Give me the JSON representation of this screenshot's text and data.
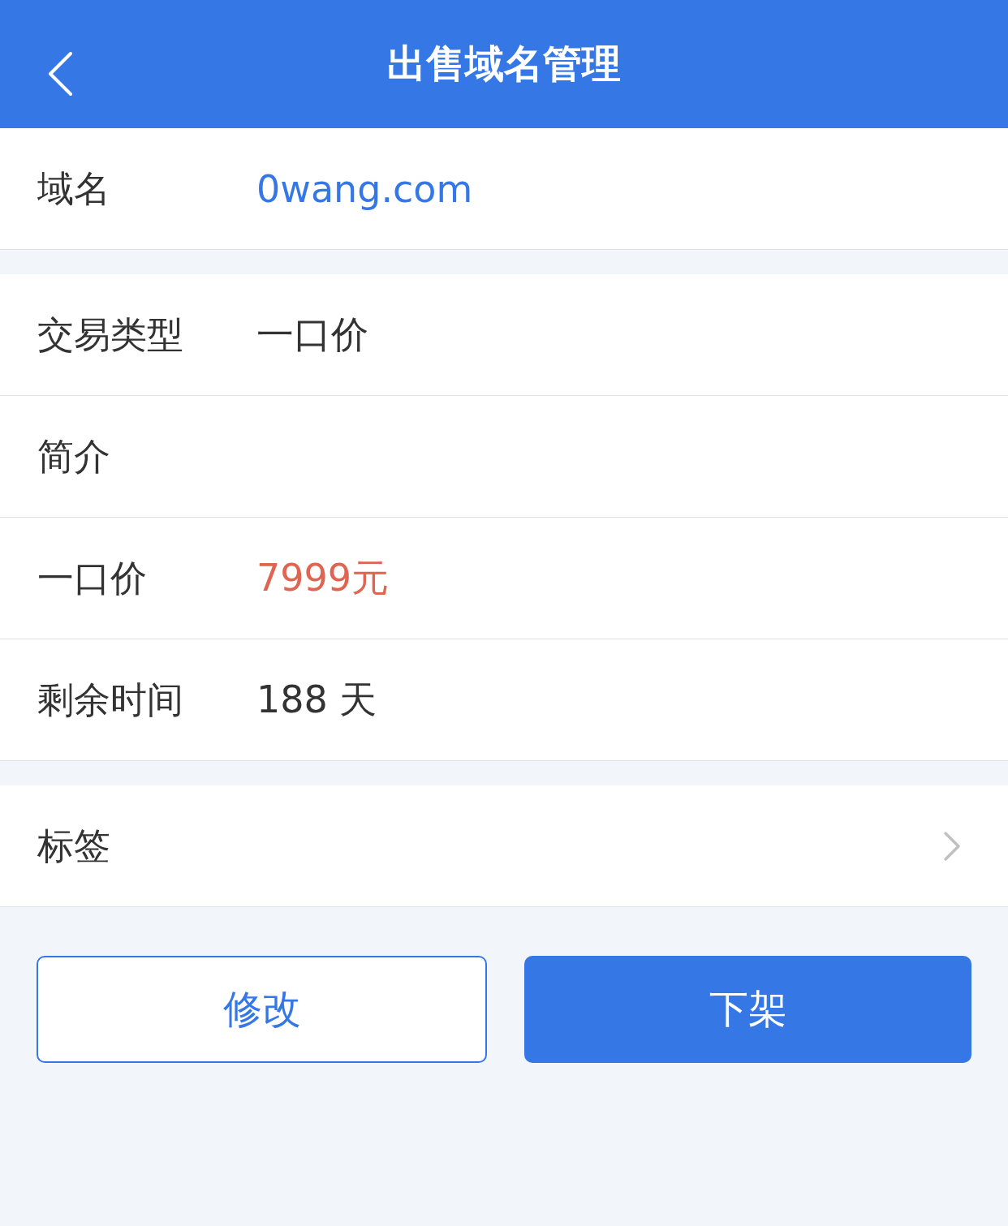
{
  "header": {
    "title": "出售域名管理"
  },
  "sections": [
    {
      "rows": [
        {
          "label": "域名",
          "value": "0wang.com",
          "kind": "link"
        }
      ]
    },
    {
      "rows": [
        {
          "label": "交易类型",
          "value": "一口价",
          "kind": "plain"
        },
        {
          "label": "简介",
          "kind": "plain"
        },
        {
          "label": "一口价",
          "value": "7999元",
          "kind": "price"
        },
        {
          "label": "剩余时间",
          "value": "188 天",
          "kind": "plain"
        }
      ]
    },
    {
      "rows": [
        {
          "label": "标签",
          "kind": "nav"
        }
      ]
    }
  ],
  "buttons": [
    {
      "label": "修改",
      "kind": "outline"
    },
    {
      "label": "下架",
      "kind": "primary"
    }
  ]
}
